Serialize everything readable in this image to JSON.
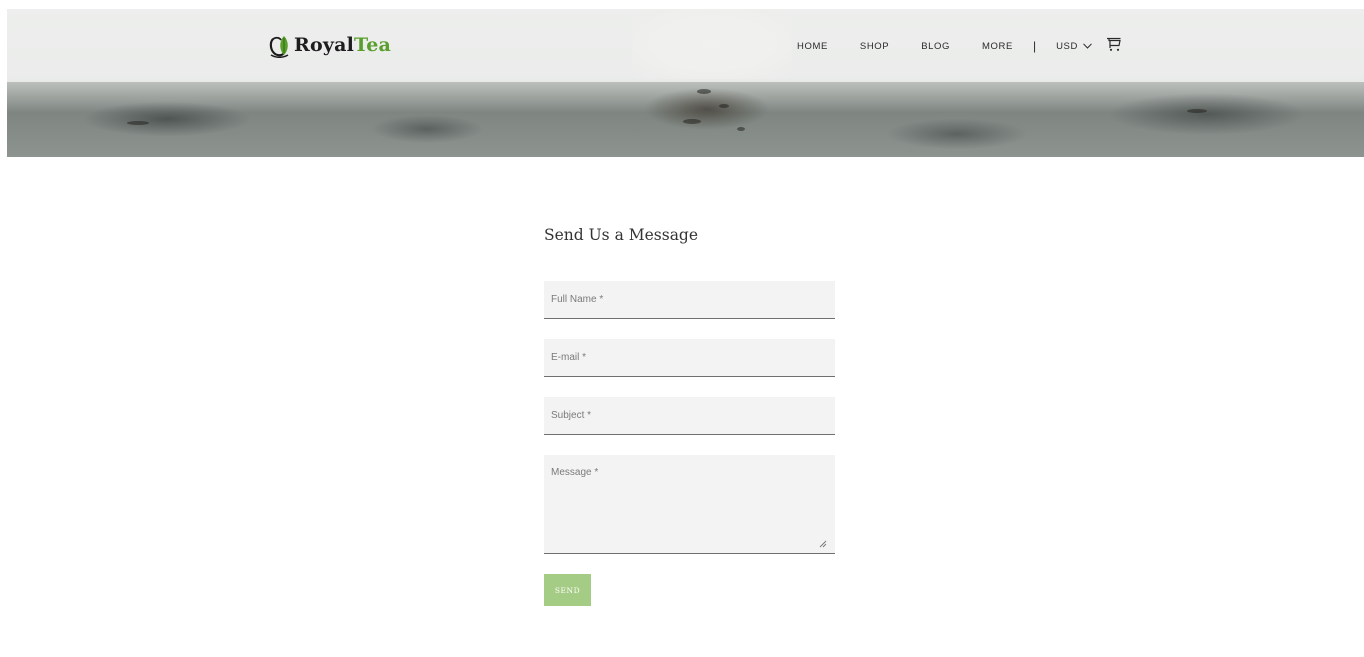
{
  "header": {
    "logo": {
      "text_main": "Royal",
      "text_accent": "Tea",
      "icon": "teacup-leaf-icon"
    },
    "nav": {
      "home": "HOME",
      "shop": "SHOP",
      "blog": "BLOG",
      "more": "MORE",
      "separator": "|",
      "currency": "USD",
      "cart_icon": "cart-icon"
    }
  },
  "form": {
    "title": "Send Us a Message",
    "full_name_placeholder": "Full Name *",
    "email_placeholder": "E-mail *",
    "subject_placeholder": "Subject *",
    "message_placeholder": "Message *",
    "send_label": "SEND"
  },
  "colors": {
    "accent_green": "#5a9e2d",
    "button_green": "#a5cc84",
    "field_bg": "#f3f3f3"
  }
}
